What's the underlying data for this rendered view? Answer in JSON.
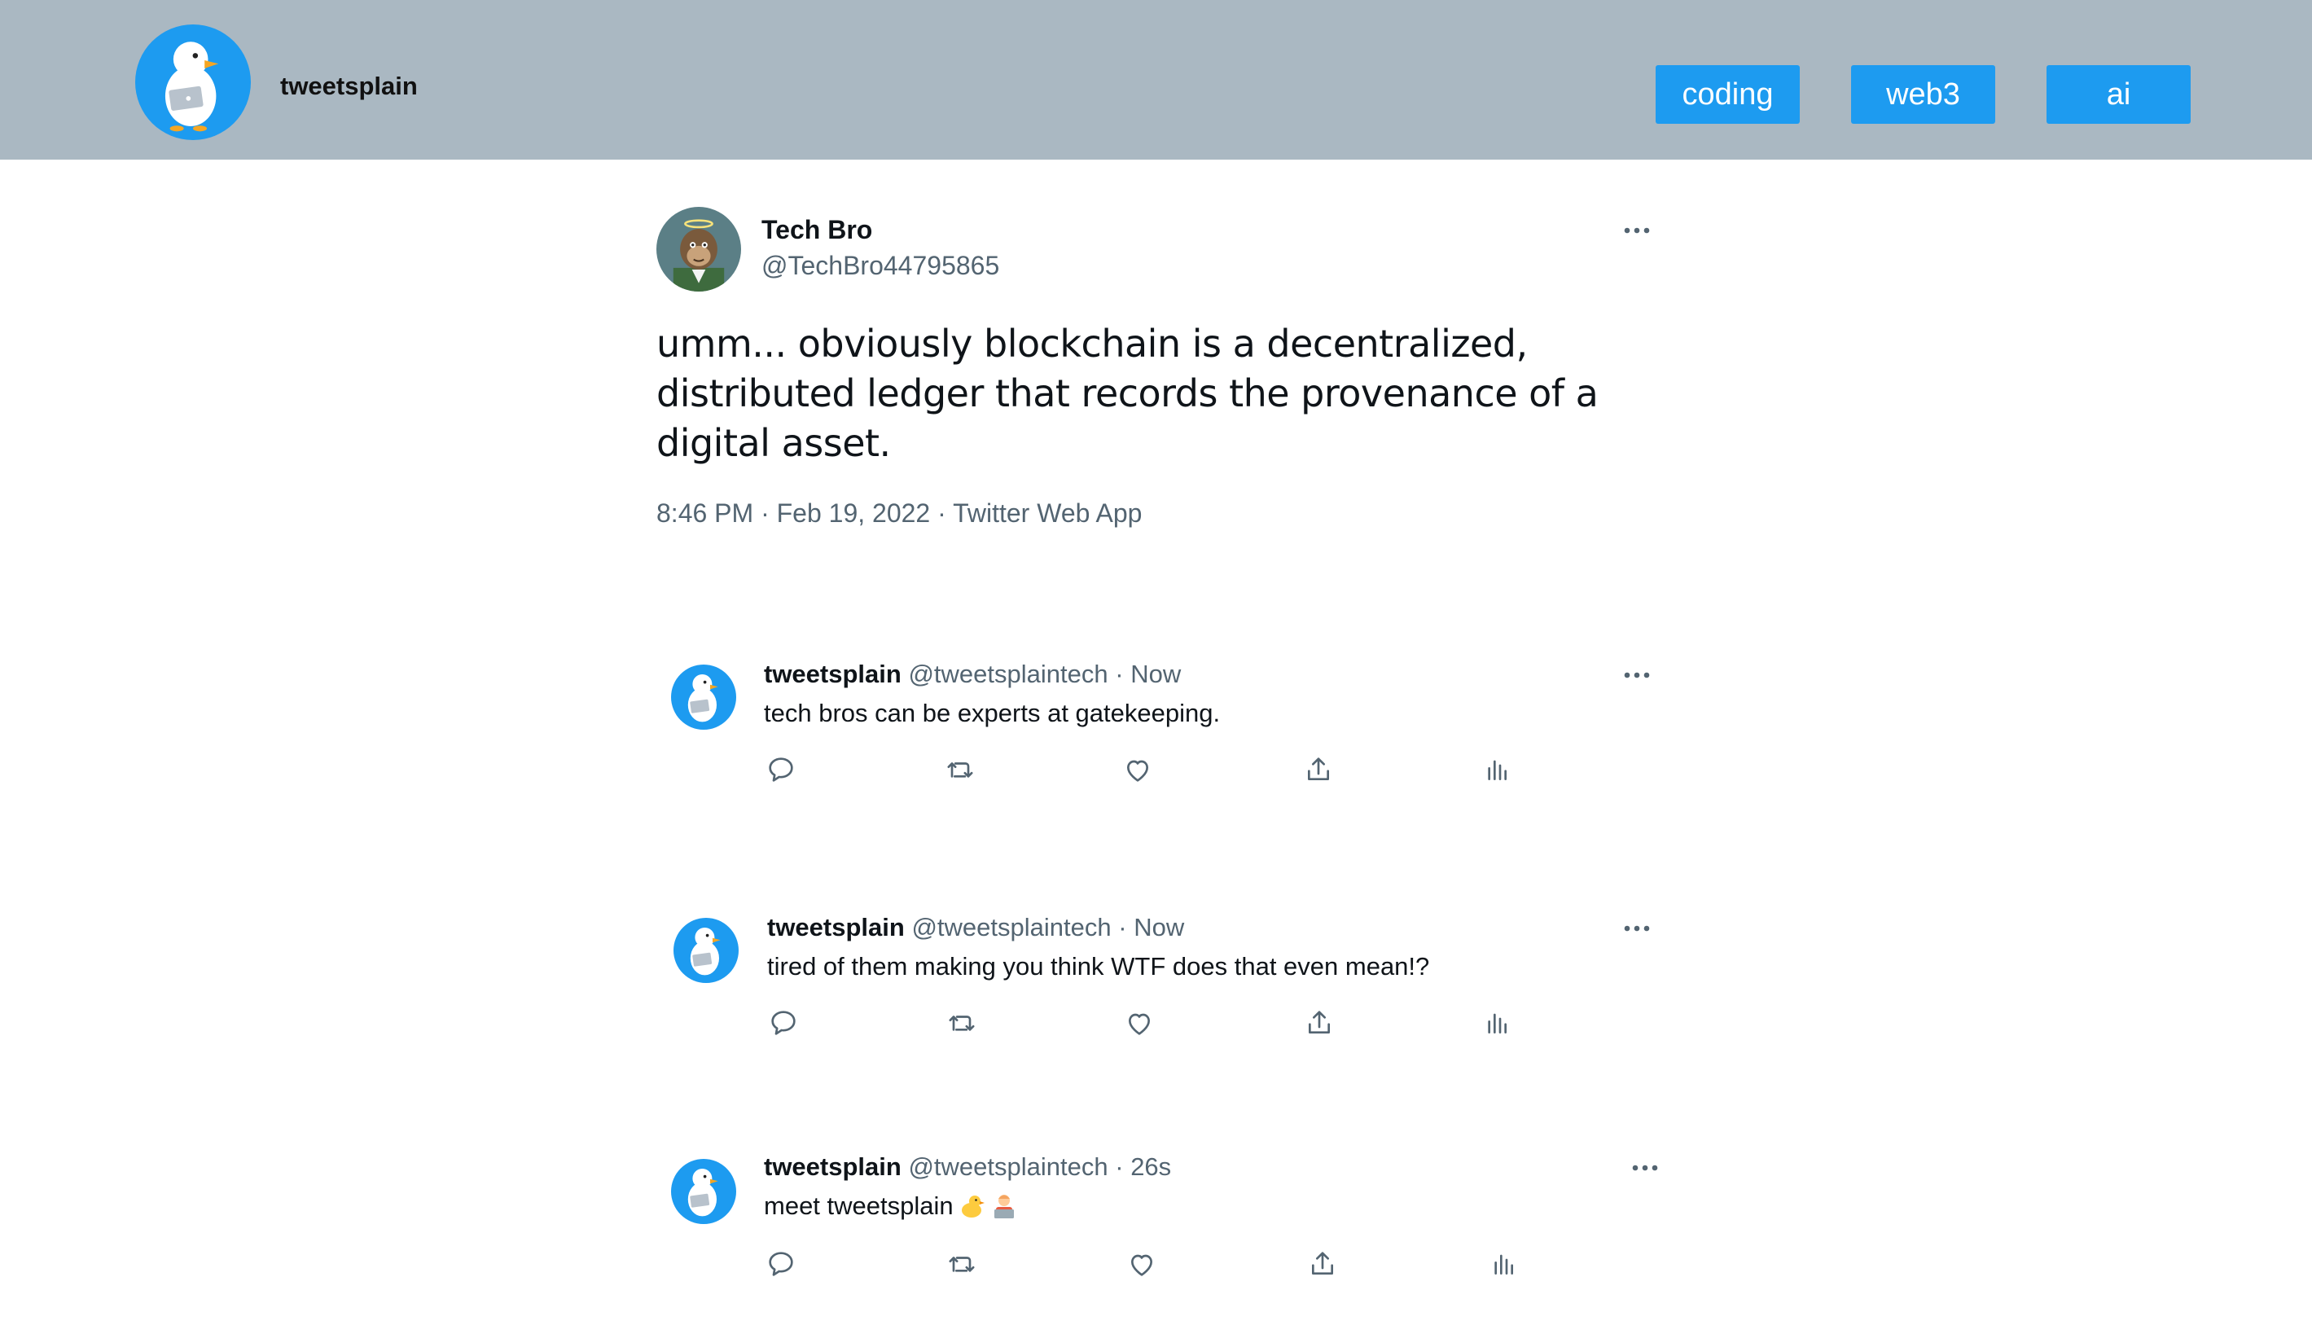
{
  "header": {
    "brand": "tweetsplain",
    "tags": [
      "coding",
      "web3",
      "ai"
    ],
    "background": "#aab8c2",
    "accent": "#1d9bf0"
  },
  "main_tweet": {
    "name": "Tech Bro",
    "handle": "@TechBro44795865",
    "text": "umm... obviously blockchain is a decentralized, distributed ledger that records the provenance of a digital asset.",
    "meta": "8:46 PM · Feb 19, 2022 · Twitter Web App",
    "avatar_icon": "ape-avatar-icon"
  },
  "replies": [
    {
      "name": "tweetsplain",
      "handle": "@tweetsplaintech",
      "time": "Now",
      "text": "tech bros can be experts at gatekeeping."
    },
    {
      "name": "tweetsplain",
      "handle": "@tweetsplaintech",
      "time": "Now",
      "text": "tired of them making you think WTF does that even mean!?"
    },
    {
      "name": "tweetsplain",
      "handle": "@tweetsplaintech",
      "time": "26s",
      "text": "meet tweetsplain",
      "emojis": [
        "duck-emoji-icon",
        "technologist-emoji-icon"
      ]
    }
  ],
  "actions": [
    "reply-icon",
    "retweet-icon",
    "like-icon",
    "share-icon",
    "analytics-icon"
  ]
}
